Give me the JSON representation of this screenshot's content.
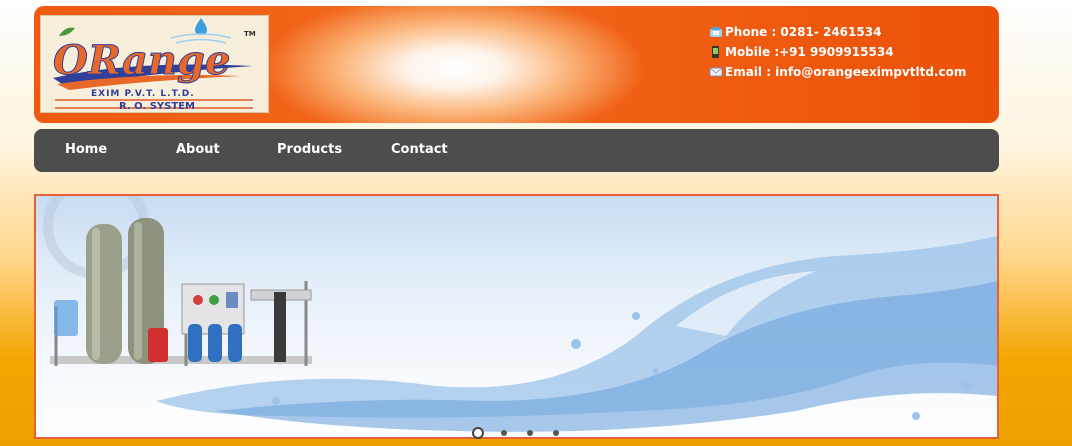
{
  "header": {
    "logo": {
      "brand": "ORange",
      "tm": "TM",
      "company": "EXIM P.V.T. L.T.D.",
      "product": "R. O. SYSTEM"
    },
    "contact": [
      {
        "icon": "phone-icon",
        "text": "Phone : 0281- 2461534"
      },
      {
        "icon": "mobile-icon",
        "text": "Mobile :+91 9909915534"
      },
      {
        "icon": "email-icon",
        "text": "Email  : info@orangeeximpvtltd.com"
      }
    ]
  },
  "nav": {
    "items": [
      "Home",
      "About",
      "Products",
      "Contact"
    ]
  },
  "slider": {
    "image": "ro-plant-water-splash",
    "slide_count": 4,
    "active_slide": 1
  },
  "colors": {
    "header_orange": "#f05a10",
    "nav_bg": "#4d4d4d",
    "slider_border": "#e8603a",
    "page_bottom": "#eca100"
  }
}
